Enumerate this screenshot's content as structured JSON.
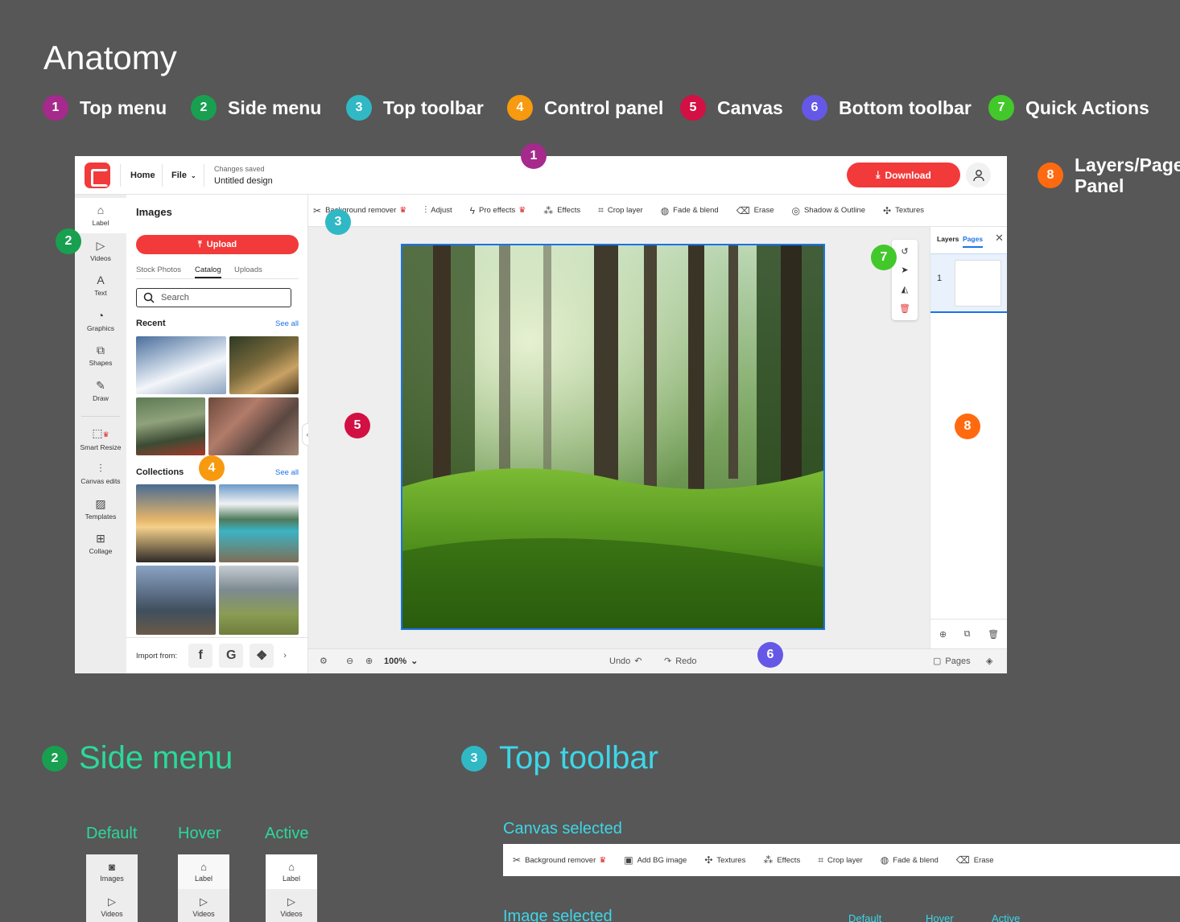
{
  "title": "Anatomy",
  "legend": [
    {
      "num": "1",
      "label": "Top menu",
      "color": "#a52a8c"
    },
    {
      "num": "2",
      "label": "Side menu",
      "color": "#18a050"
    },
    {
      "num": "3",
      "label": "Top toolbar",
      "color": "#30b8c5"
    },
    {
      "num": "4",
      "label": "Control panel",
      "color": "#f79a0f"
    },
    {
      "num": "5",
      "label": "Canvas",
      "color": "#d31043"
    },
    {
      "num": "6",
      "label": "Bottom toolbar",
      "color": "#6558e6"
    },
    {
      "num": "7",
      "label": "Quick Actions",
      "color": "#42c82a"
    },
    {
      "num": "8",
      "label": "Layers/Pages Panel",
      "color": "#ff6a10"
    }
  ],
  "side_label": {
    "line1": "Layers/Page",
    "line2": "Panel"
  },
  "editor": {
    "topmenu": {
      "home": "Home",
      "file": "File",
      "saved": "Changes saved",
      "design_name": "Untitled design",
      "download": "Download"
    },
    "sidemenu": [
      {
        "label": "Label",
        "icon": "home-icon"
      },
      {
        "label": "Videos",
        "icon": "video-icon"
      },
      {
        "label": "Text",
        "icon": "text-icon"
      },
      {
        "label": "Graphics",
        "icon": "graphics-icon"
      },
      {
        "label": "Shapes",
        "icon": "shapes-icon"
      },
      {
        "label": "Draw",
        "icon": "pen-icon"
      },
      {
        "label": "Smart Resize",
        "icon": "resize-icon"
      },
      {
        "label": "Canvas edits",
        "icon": "sliders-icon"
      },
      {
        "label": "Templates",
        "icon": "templates-icon"
      },
      {
        "label": "Collage",
        "icon": "collage-icon"
      }
    ],
    "control": {
      "title": "Images",
      "upload": "Upload",
      "tabs": [
        "Stock Photos",
        "Catalog",
        "Uploads"
      ],
      "search_placeholder": "Search",
      "recent": "Recent",
      "collections": "Collections",
      "see_all": "See all",
      "import_from": "Import from:"
    },
    "toolbar": [
      "Background remover",
      "Adjust",
      "Pro effects",
      "Effects",
      "Crop layer",
      "Fade & blend",
      "Erase",
      "Shadow & Outline",
      "Textures"
    ],
    "layers": {
      "tab_layers": "Layers",
      "tab_pages": "Pages",
      "page_num": "1"
    },
    "bottombar": {
      "zoom": "100%",
      "undo": "Undo",
      "redo": "Redo",
      "pages": "Pages"
    }
  },
  "sections": {
    "side_menu": {
      "num": "2",
      "title": "Side menu",
      "states": [
        "Default",
        "Hover",
        "Active"
      ],
      "item1_default": "Images",
      "item1": "Label",
      "item2": "Videos"
    },
    "top_toolbar": {
      "num": "3",
      "title": "Top toolbar",
      "canvas_selected": "Canvas selected",
      "image_selected": "Image selected",
      "states": [
        "Default",
        "Hover",
        "Active"
      ],
      "canvas_tools": [
        "Background remover",
        "Add BG image",
        "Textures",
        "Effects",
        "Crop layer",
        "Fade & blend",
        "Erase"
      ]
    }
  }
}
